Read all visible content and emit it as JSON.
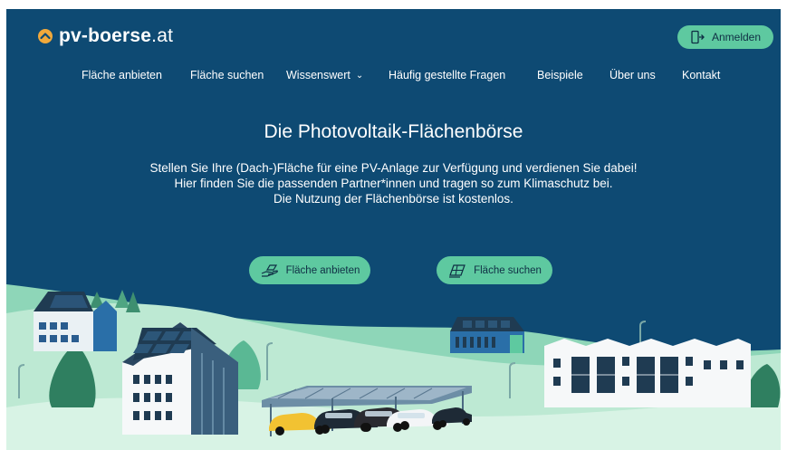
{
  "brand": {
    "name_bold": "pv-boerse",
    "name_tld": ".at",
    "accent": "#5ec9a0",
    "background": "#0e4a73",
    "logo_icon": "sun-chevron-icon"
  },
  "header": {
    "login_label": "Anmelden",
    "login_icon": "door-enter-icon"
  },
  "nav": {
    "items": [
      {
        "label": "Fläche anbieten"
      },
      {
        "label": "Fläche suchen"
      },
      {
        "label": "Wissenswert",
        "has_dropdown": true
      },
      {
        "label": "Häufig gestellte Fragen"
      },
      {
        "label": "Beispiele"
      },
      {
        "label": "Über uns"
      },
      {
        "label": "Kontakt"
      }
    ]
  },
  "hero": {
    "title": "Die Photovoltaik-Flächenbörse",
    "lines": [
      "Stellen Sie Ihre (Dach-)Fläche für eine PV-Anlage zur Verfügung und verdienen Sie dabei!",
      "Hier finden Sie die passenden Partner*innen und tragen so zum Klimaschutz bei.",
      "Die Nutzung der Flächenbörse ist kostenlos."
    ],
    "cta_offer": {
      "label": "Fläche anbieten",
      "icon": "hand-offer-icon"
    },
    "cta_search": {
      "label": "Fläche suchen",
      "icon": "solar-panel-search-icon"
    }
  }
}
